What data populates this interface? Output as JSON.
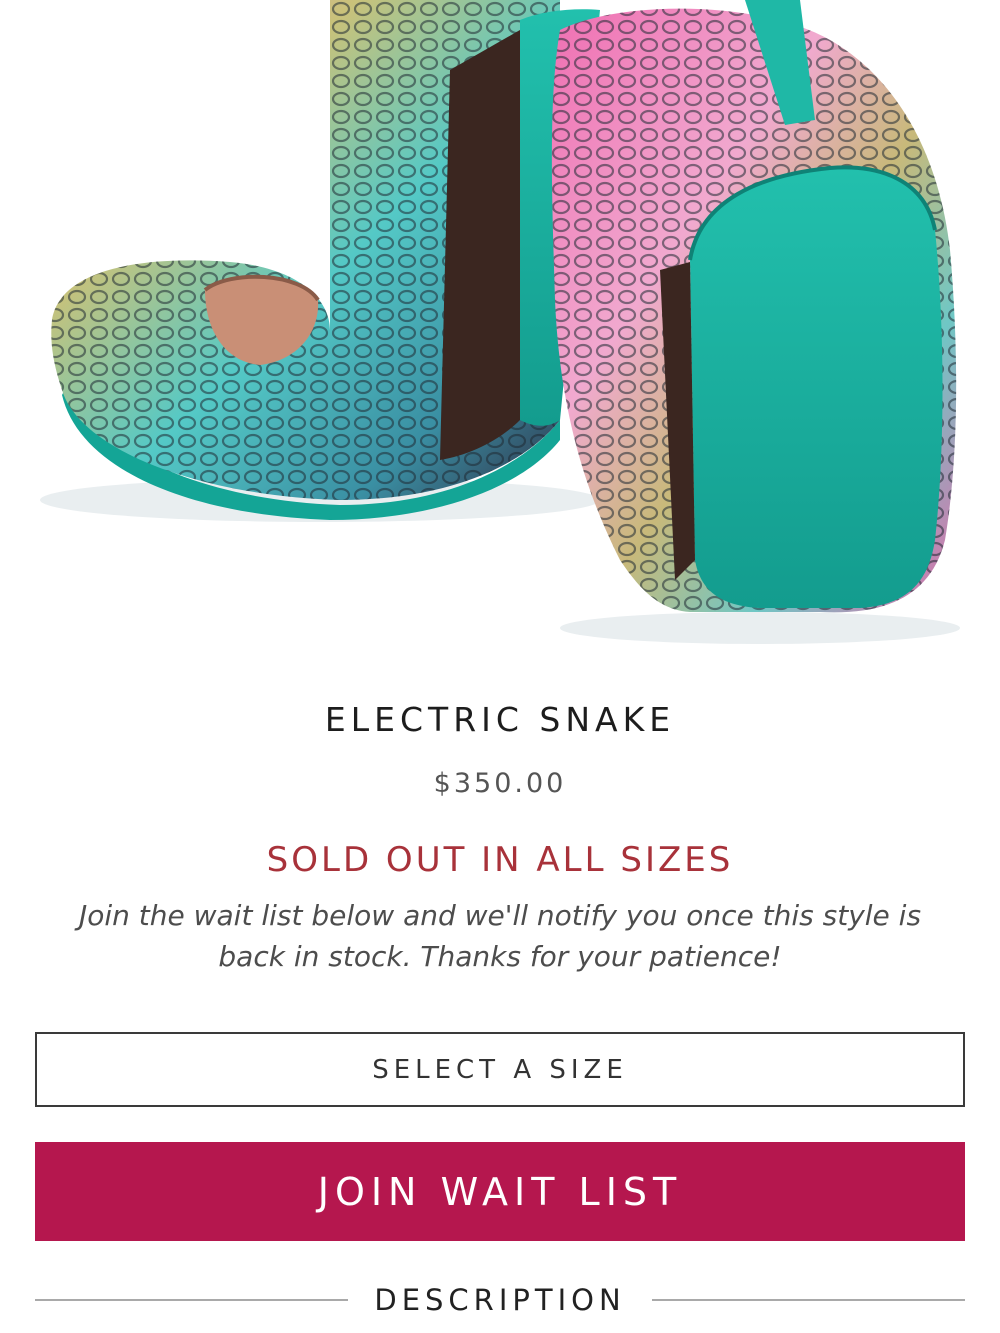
{
  "hero": {
    "image_label": "product-photo-snake-print-ballet-flats",
    "sole_color": "#1fb3a3",
    "accent_pink": "#e85ea6"
  },
  "product": {
    "title": "ELECTRIC SNAKE",
    "price": "$350.00",
    "status": "SOLD OUT IN ALL SIZES",
    "notice": "Join the wait list below and we'll notify you once this style is back in stock. Thanks for your patience!"
  },
  "size_select": {
    "label": "SELECT A SIZE"
  },
  "waitlist": {
    "label": "JOIN WAIT LIST",
    "color": "#b5174e"
  },
  "description": {
    "label": "DESCRIPTION"
  }
}
